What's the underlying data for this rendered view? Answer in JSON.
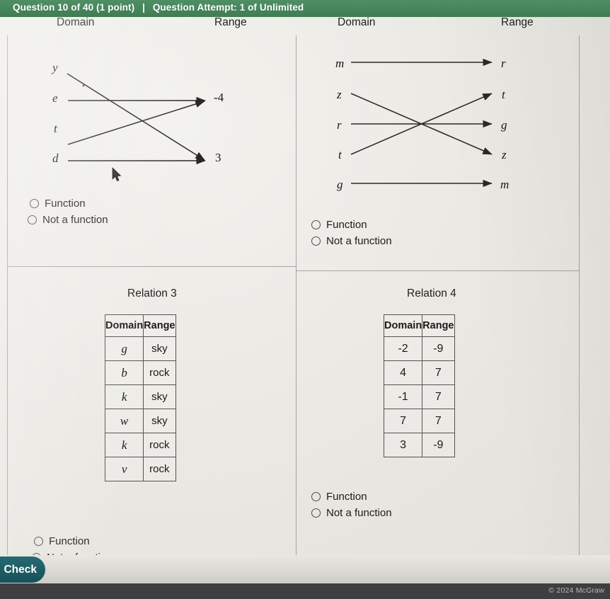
{
  "header": {
    "question_label": "Question 10 of 40 (1 point)",
    "separator": "|",
    "attempt_label": "Question Attempt: 1 of Unlimited"
  },
  "colors": {
    "header_green": "#46865b",
    "check_teal": "#1d5b63",
    "footer_dark": "#3f3f41",
    "paper": "#eceae5"
  },
  "relation1": {
    "domain_heading": "Domain",
    "range_heading": "Range",
    "domain_items": [
      "y",
      "e",
      "t",
      "d"
    ],
    "range_items": [
      "-4",
      "3"
    ],
    "mappings": [
      {
        "from": "y",
        "to": "3"
      },
      {
        "from": "e",
        "to": "-4"
      },
      {
        "from": "t",
        "to": "-4"
      },
      {
        "from": "d",
        "to": "3"
      }
    ],
    "options": [
      "Function",
      "Not a function"
    ],
    "selected": null
  },
  "relation2": {
    "domain_heading": "Domain",
    "range_heading": "Range",
    "domain_items": [
      "m",
      "z",
      "r",
      "t",
      "g"
    ],
    "range_items": [
      "r",
      "t",
      "g",
      "z",
      "m"
    ],
    "mappings": [
      {
        "from": "m",
        "to": "r"
      },
      {
        "from": "z",
        "to": "z"
      },
      {
        "from": "r",
        "to": "g"
      },
      {
        "from": "t",
        "to": "t"
      },
      {
        "from": "g",
        "to": "m"
      }
    ],
    "options": [
      "Function",
      "Not a function"
    ],
    "selected": null
  },
  "relation3": {
    "title": "Relation 3",
    "columns": [
      "Domain",
      "Range"
    ],
    "rows": [
      [
        "g",
        "sky"
      ],
      [
        "b",
        "rock"
      ],
      [
        "k",
        "sky"
      ],
      [
        "w",
        "sky"
      ],
      [
        "k",
        "rock"
      ],
      [
        "v",
        "rock"
      ]
    ],
    "options": [
      "Function",
      "Not a function"
    ],
    "selected": null
  },
  "relation4": {
    "title": "Relation 4",
    "columns": [
      "Domain",
      "Range"
    ],
    "rows": [
      [
        "-2",
        "-9"
      ],
      [
        "4",
        "7"
      ],
      [
        "-1",
        "7"
      ],
      [
        "7",
        "7"
      ],
      [
        "3",
        "-9"
      ]
    ],
    "options": [
      "Function",
      "Not a function"
    ],
    "selected": null
  },
  "toolbar": {
    "check_label": "Check"
  },
  "footer": {
    "copyright": "© 2024 McGraw"
  }
}
